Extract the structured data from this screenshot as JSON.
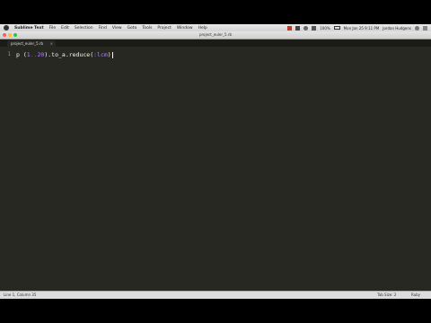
{
  "menubar": {
    "app_name": "Sublime Text",
    "items": [
      "File",
      "Edit",
      "Selection",
      "Find",
      "View",
      "Goto",
      "Tools",
      "Project",
      "Window",
      "Help"
    ],
    "clock": "Mon Jan 25  9:11 PM",
    "user": "Jordan Hudgens",
    "battery": "100%"
  },
  "window": {
    "title": "project_euler_5.rb"
  },
  "tab": {
    "label": "project_euler_5.rb",
    "close": "×"
  },
  "editor": {
    "line_number": "1",
    "code": {
      "p": "p ",
      "lparen": "(",
      "start": "1",
      "range_op": "..",
      "end": "20",
      "rparen": ")",
      "method1": ".to_a.reduce(",
      "symbol": ":lcm",
      "close": ")"
    }
  },
  "statusbar": {
    "position": "Line 1, Column 35",
    "tab_size": "Tab Size: 2",
    "syntax": "Ruby"
  },
  "colors": {
    "editor_bg": "#272822",
    "foreground": "#f8f8f2",
    "number": "#ae81ff",
    "close_red": "#ff5f57",
    "minimize_yellow": "#febc2e",
    "zoom_green": "#28c840"
  }
}
